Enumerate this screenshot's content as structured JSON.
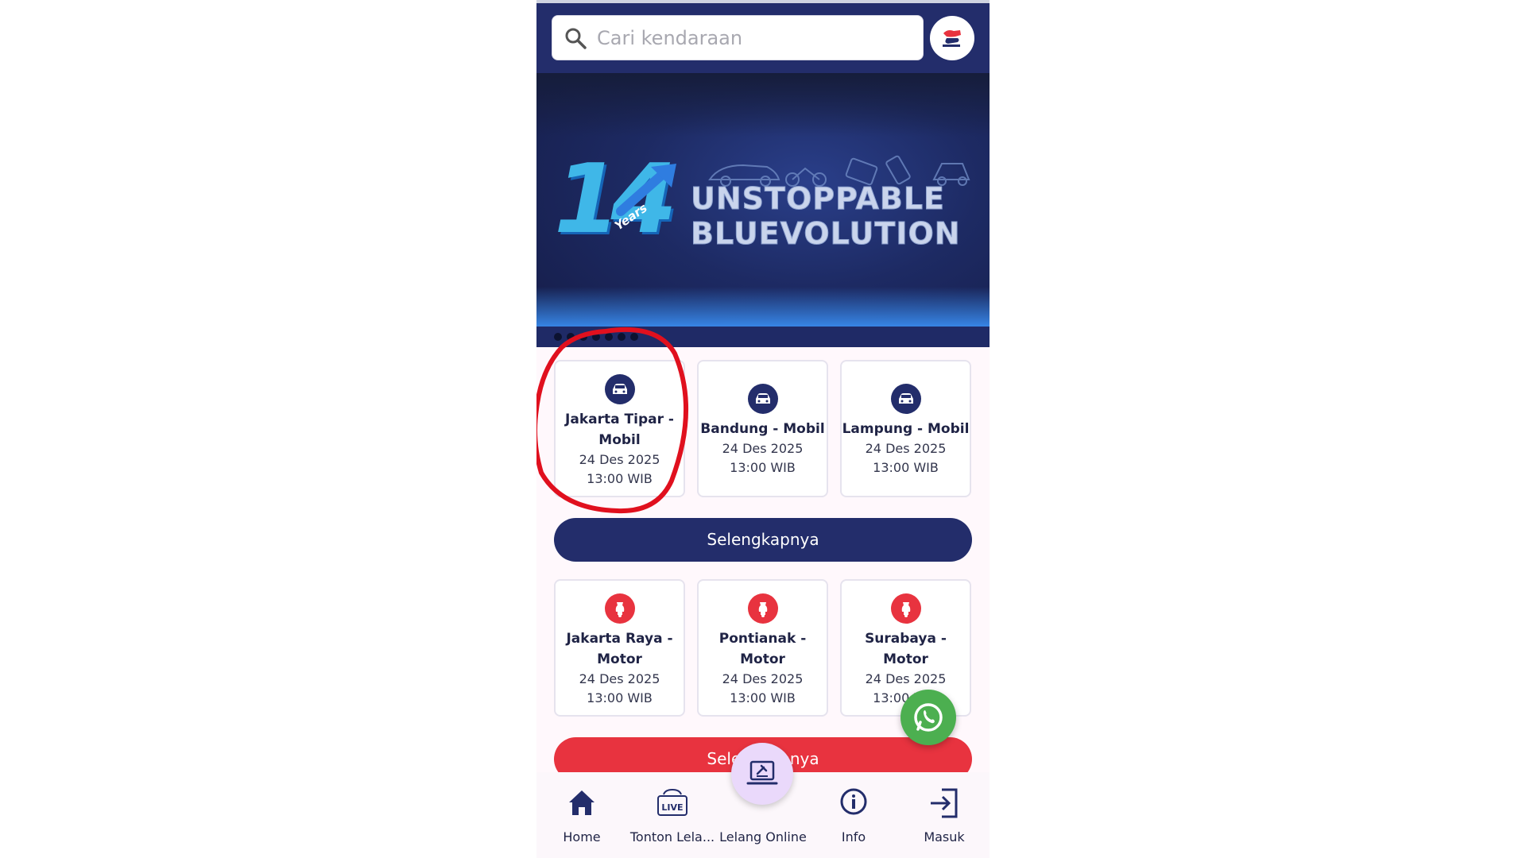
{
  "search": {
    "placeholder": "Cari kendaraan"
  },
  "banner": {
    "years_number": "14",
    "years_label": "Years",
    "headline_line1": "UNSTOPPABLE",
    "headline_line2": "BLUEVOLUTION",
    "slide_count": 7
  },
  "car_auctions": [
    {
      "title": "Jakarta Tipar - Mobil",
      "date": "24 Des 2025",
      "time": "13:00 WIB"
    },
    {
      "title": "Bandung - Mobil",
      "date": "24 Des 2025",
      "time": "13:00 WIB"
    },
    {
      "title": "Lampung - Mobil",
      "date": "24 Des 2025",
      "time": "13:00 WIB"
    }
  ],
  "car_more_label": "Selengkapnya",
  "moto_auctions": [
    {
      "title": "Jakarta Raya - Motor",
      "date": "24 Des 2025",
      "time": "13:00 WIB"
    },
    {
      "title": "Pontianak - Motor",
      "date": "24 Des 2025",
      "time": "13:00 WIB"
    },
    {
      "title": "Surabaya - Motor",
      "date": "24 Des 2025",
      "time": "13:00 WIB"
    }
  ],
  "moto_more_label": "Selengkapnya",
  "bottom_nav": [
    {
      "label": "Home",
      "icon": "home-icon"
    },
    {
      "label": "Tonton Lela...",
      "icon": "live-icon"
    },
    {
      "label": "Lelang Online",
      "icon": "laptop-auction-icon"
    },
    {
      "label": "Info",
      "icon": "info-icon"
    },
    {
      "label": "Masuk",
      "icon": "login-icon"
    }
  ],
  "colors": {
    "navy": "#232d6b",
    "red": "#e8333f",
    "whatsapp": "#4caf50",
    "annotation": "#e0101e"
  }
}
